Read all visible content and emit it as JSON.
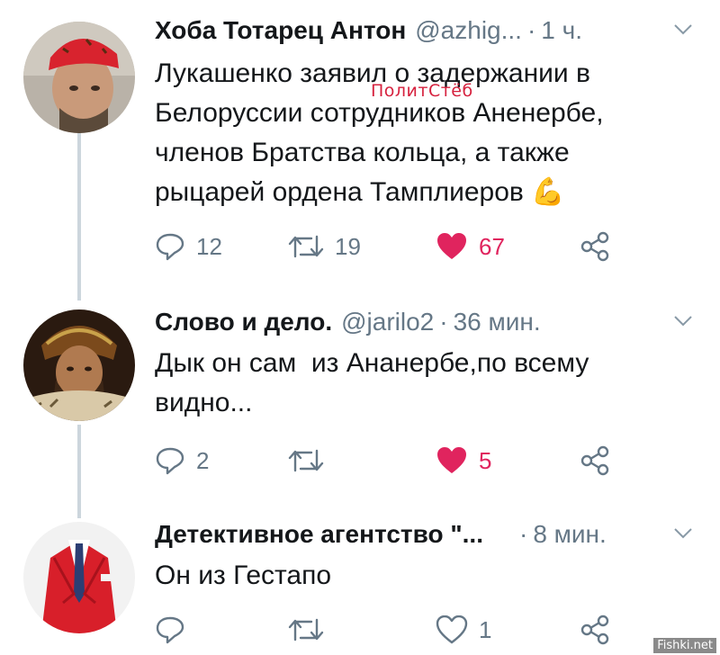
{
  "tweets": [
    {
      "name": "Хоба Тотарец Антон",
      "handle": "@azhig...",
      "separator": "·",
      "time": "1 ч.",
      "text_lines": [
        "Лукашенко заявил о задержании в",
        "Белоруссии сотрудников Аненербе,",
        "членов Братства кольца, а также",
        "рыцарей ордена Тамплиеров"
      ],
      "emoji": "💪",
      "replies": "12",
      "retweets": "19",
      "likes": "67"
    },
    {
      "name": "Слово и дело.",
      "handle": "@jarilo2",
      "separator": "·",
      "time": "36 мин.",
      "text_lines": [
        "Дык он сам  из Ананербе,по всему",
        "видно..."
      ],
      "replies": "2",
      "retweets": "",
      "likes": "5"
    },
    {
      "name": "Детективное агентство \"...",
      "handle": "",
      "separator": "·",
      "time": "8 мин.",
      "text_lines": [
        "Он из Гестапо"
      ],
      "replies": "",
      "retweets": "",
      "likes": "1"
    }
  ],
  "watermark": "ПолитСтёб",
  "site_mark": "Fishki.net",
  "colors": {
    "like_active": "#e0245e",
    "icon_gray": "#657786",
    "thread_line": "#ccd6dd"
  }
}
